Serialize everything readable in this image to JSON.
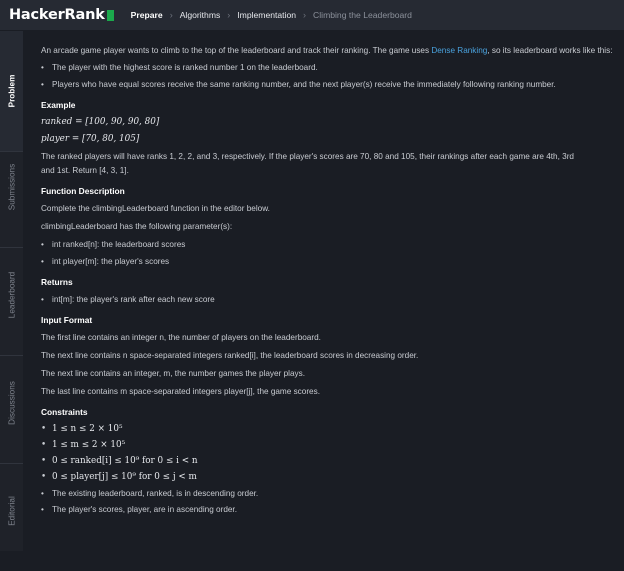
{
  "header": {
    "logo_text": "HackerRank",
    "crumbs": [
      "Prepare",
      "Algorithms",
      "Implementation",
      "Climbing the Leaderboard"
    ],
    "separator": "›"
  },
  "sidebar": {
    "tabs": [
      "Problem",
      "Submissions",
      "Leaderboard",
      "Discussions",
      "Editorial"
    ]
  },
  "problem": {
    "intro_before_link": "An arcade game player wants to climb to the top of the leaderboard and track their ranking. The game uses ",
    "intro_link": "Dense Ranking",
    "intro_after_link": ", so its leaderboard works like this:",
    "rules": [
      "The player with the highest score is ranked number 1 on the leaderboard.",
      "Players who have equal scores receive the same ranking number, and the next player(s) receive the immediately following ranking number."
    ],
    "example_heading": "Example",
    "ranked_eq": "ranked = [100, 90, 90, 80]",
    "player_eq": "player = [70, 80, 105]",
    "example_line1": "The ranked players will have ranks 1, 2, 2, and 3, respectively. If the player's scores are 70, 80 and 105, their rankings after each game are 4th, 3rd",
    "example_line2": "and 1st. Return [4, 3, 1].",
    "function_heading": "Function Description",
    "function_text": "Complete the climbingLeaderboard function in the editor below.",
    "params_text": "climbingLeaderboard has the following parameter(s):",
    "params": [
      "int ranked[n]: the leaderboard scores",
      "int player[m]: the player's scores"
    ],
    "returns_heading": "Returns",
    "returns": [
      "int[m]: the player's rank after each new score"
    ],
    "input_heading": "Input Format",
    "input_lines": [
      "The first line contains an integer n, the number of players on the leaderboard.",
      "The next line contains n space-separated integers ranked[i], the leaderboard scores in decreasing order.",
      "The next line contains an integer, m, the number games the player plays.",
      "The last line contains m space-separated integers player[j], the game scores."
    ],
    "constraints_heading": "Constraints",
    "constraints": [
      "1 ≤ n ≤ 2 × 10⁵",
      "1 ≤ m ≤ 2 × 10⁵",
      "0 ≤ ranked[i] ≤ 10⁹ for 0 ≤ i < n",
      "0 ≤ player[j] ≤ 10⁹ for 0 ≤ j < m",
      "The existing leaderboard, ranked, is in descending order.",
      "The player's scores, player, are in ascending order."
    ]
  }
}
